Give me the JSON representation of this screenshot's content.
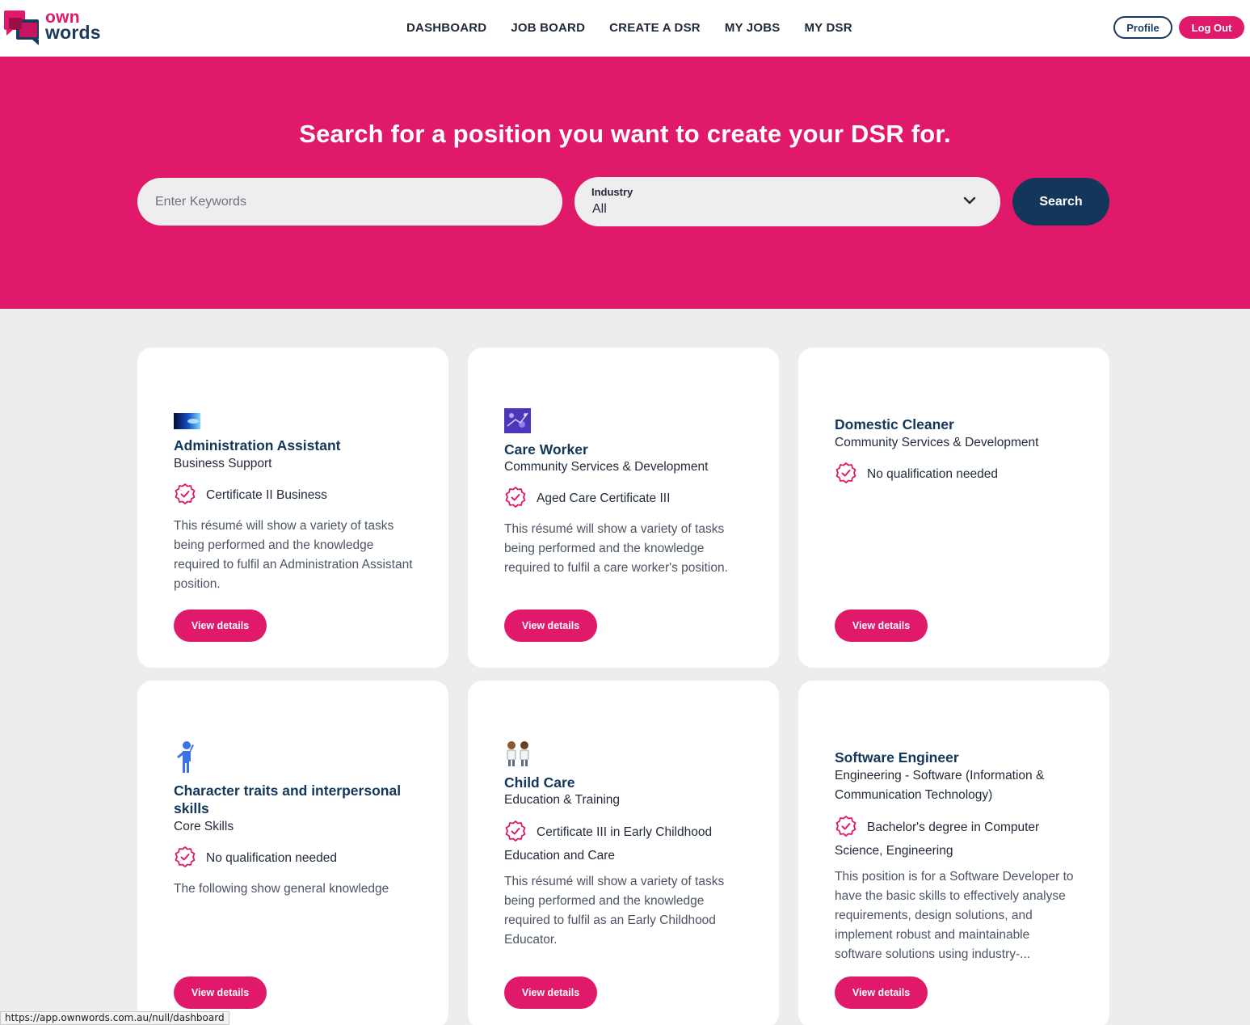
{
  "brand": {
    "line1": "own",
    "line2": "words",
    "accent": "#e0196a",
    "navy": "#13375a"
  },
  "nav": [
    {
      "label": "DASHBOARD"
    },
    {
      "label": "JOB BOARD"
    },
    {
      "label": "CREATE A DSR"
    },
    {
      "label": "MY JOBS"
    },
    {
      "label": "MY DSR"
    }
  ],
  "header": {
    "profile_label": "Profile",
    "logout_label": "Log Out"
  },
  "hero": {
    "title": "Search for a position you want to create your DSR for.",
    "keywords_placeholder": "Enter Keywords",
    "industry_label": "Industry",
    "industry_value": "All",
    "search_label": "Search"
  },
  "cards": [
    {
      "icon": "blue-light-image",
      "title": "Administration Assistant",
      "industry": "Business Support",
      "qualification": "Certificate II Business",
      "description": "This résumé will show a variety of tasks being performed and the knowledge required to fulfil an Administration Assistant position.",
      "button": "View details"
    },
    {
      "icon": "purple-pattern-image",
      "title": "Care Worker",
      "industry": "Community Services & Development",
      "qualification": "Aged Care Certificate III",
      "description": "This résumé will show a variety of tasks being performed and the knowledge required to fulfil a care worker's position.",
      "button": "View details"
    },
    {
      "icon": "",
      "title": "Domestic Cleaner",
      "industry": "Community Services & Development",
      "qualification": "No qualification needed",
      "description": "",
      "button": "View details"
    },
    {
      "icon": "person-figure-icon",
      "title": "Character traits and interpersonal skills",
      "industry": "Core Skills",
      "qualification": "No qualification needed",
      "description": "The following show general knowledge",
      "button": "View details"
    },
    {
      "icon": "two-people-icon",
      "title": "Child Care",
      "industry": "Education & Training",
      "qualification": "Certificate III in Early Childhood Education and Care",
      "description": "This résumé will show a variety of tasks being performed and the knowledge required to fulfil as an Early Childhood Educator.",
      "button": "View details"
    },
    {
      "icon": "",
      "title": "Software Engineer",
      "industry": "Engineering - Software (Information & Communication Technology)",
      "qualification": "Bachelor's degree in Computer Science, Engineering",
      "description": "This position is for a Software Developer to have the basic skills to effectively analyse requirements, design solutions, and implement robust and maintainable software solutions using industry-...",
      "button": "View details"
    }
  ],
  "status_bar": {
    "url": "https://app.ownwords.com.au/null/dashboard"
  }
}
